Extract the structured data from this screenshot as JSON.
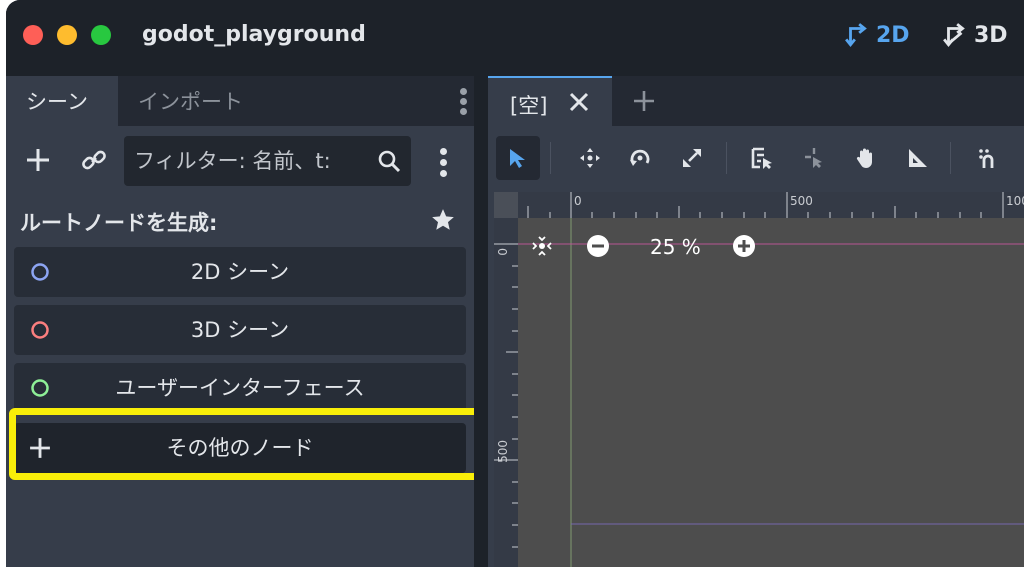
{
  "window": {
    "title": "godot_playground",
    "mode_2d": "2D",
    "mode_3d": "3D"
  },
  "dock": {
    "tabs": [
      {
        "label": "シーン",
        "active": true
      },
      {
        "label": "インポート",
        "active": false
      }
    ],
    "filter_placeholder": "フィルター: 名前、t:",
    "root_heading": "ルートノードを生成:",
    "root_buttons": [
      {
        "label": "2D シーン",
        "icon": "node2d-circle-icon",
        "color": "#8da5f3"
      },
      {
        "label": "3D シーン",
        "icon": "node3d-circle-icon",
        "color": "#fc7f7f"
      },
      {
        "label": "ユーザーインターフェース",
        "icon": "control-circle-icon",
        "color": "#8eef97"
      },
      {
        "label": "その他のノード",
        "icon": "plus-icon",
        "color": "#e3e6ea"
      }
    ]
  },
  "editor": {
    "scene_tab": "[空]",
    "ruler_top_labels": [
      "0",
      "500",
      "100"
    ],
    "ruler_left_labels": [
      "0",
      "500"
    ],
    "zoom": "25 %"
  },
  "colors": {
    "accent": "#57a5ee",
    "highlight": "#f9ee09",
    "panel": "#363d4a",
    "background": "#1d2229"
  }
}
